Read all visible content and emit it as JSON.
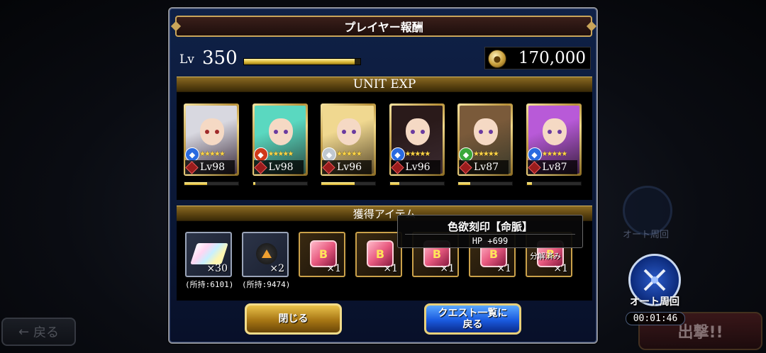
{
  "background": {
    "back_button": "戻る",
    "sortie_button": "出撃!!",
    "ghost_auto_label": "オート周回"
  },
  "dialog": {
    "title": "プレイヤー報酬",
    "player_level_label": "Lv",
    "player_level": "350",
    "player_exp_progress": 0.95,
    "coin_amount": "170,000",
    "unit_exp_header": "UNIT EXP",
    "items_header": "獲得アイテム"
  },
  "units": [
    {
      "level": "Lv98",
      "exp": 0.42,
      "element_icon": "water-icon",
      "element_color": "#2a6ae0",
      "hair": "#d8d8e0",
      "bg": "#3a2a3a"
    },
    {
      "level": "Lv98",
      "exp": 0.04,
      "element_icon": "fire-icon",
      "element_color": "#d03a1a",
      "hair": "#5ad8c0",
      "bg": "#2a4a40"
    },
    {
      "level": "Lv96",
      "exp": 0.62,
      "element_icon": "wind-icon",
      "element_color": "#c0c8d0",
      "hair": "#f0d890",
      "bg": "#5a4a2a"
    },
    {
      "level": "Lv96",
      "exp": 0.18,
      "element_icon": "water-icon",
      "element_color": "#2a6ae0",
      "hair": "#2a1a1a",
      "bg": "#3a2a30"
    },
    {
      "level": "Lv87",
      "exp": 0.22,
      "element_icon": "nature-icon",
      "element_color": "#3aa83a",
      "hair": "#7a5a3a",
      "bg": "#3a3a2a"
    },
    {
      "level": "Lv87",
      "exp": 0.1,
      "element_icon": "water-icon",
      "element_color": "#2a6ae0",
      "hair": "#b85ad8",
      "bg": "#3a2040"
    }
  ],
  "items": [
    {
      "name": "ingot",
      "qty": "×30",
      "owned": "(所持:6101)",
      "frame": "silver"
    },
    {
      "name": "fragment",
      "qty": "×2",
      "owned": "(所持:9474)",
      "frame": "silver"
    },
    {
      "name": "gem",
      "qty": "×1",
      "owned": "",
      "frame": "gold",
      "glyph": "B"
    },
    {
      "name": "gem",
      "qty": "×1",
      "owned": "",
      "frame": "gold",
      "glyph": "B"
    },
    {
      "name": "gem",
      "qty": "×1",
      "owned": "",
      "frame": "gold",
      "glyph": "B"
    },
    {
      "name": "gem",
      "qty": "×1",
      "owned": "",
      "frame": "gold",
      "glyph": "B"
    },
    {
      "name": "gem",
      "qty": "×1",
      "owned": "",
      "frame": "gold",
      "glyph": "B",
      "note": "分解済み"
    }
  ],
  "tooltip": {
    "name": "色欲刻印【命脈】",
    "stat": "HP +699"
  },
  "buttons": {
    "close": "閉じる",
    "back_to_list_line1": "クエスト一覧に",
    "back_to_list_line2": "戻る"
  },
  "auto": {
    "label": "オート周回",
    "timer": "00:01:46"
  }
}
